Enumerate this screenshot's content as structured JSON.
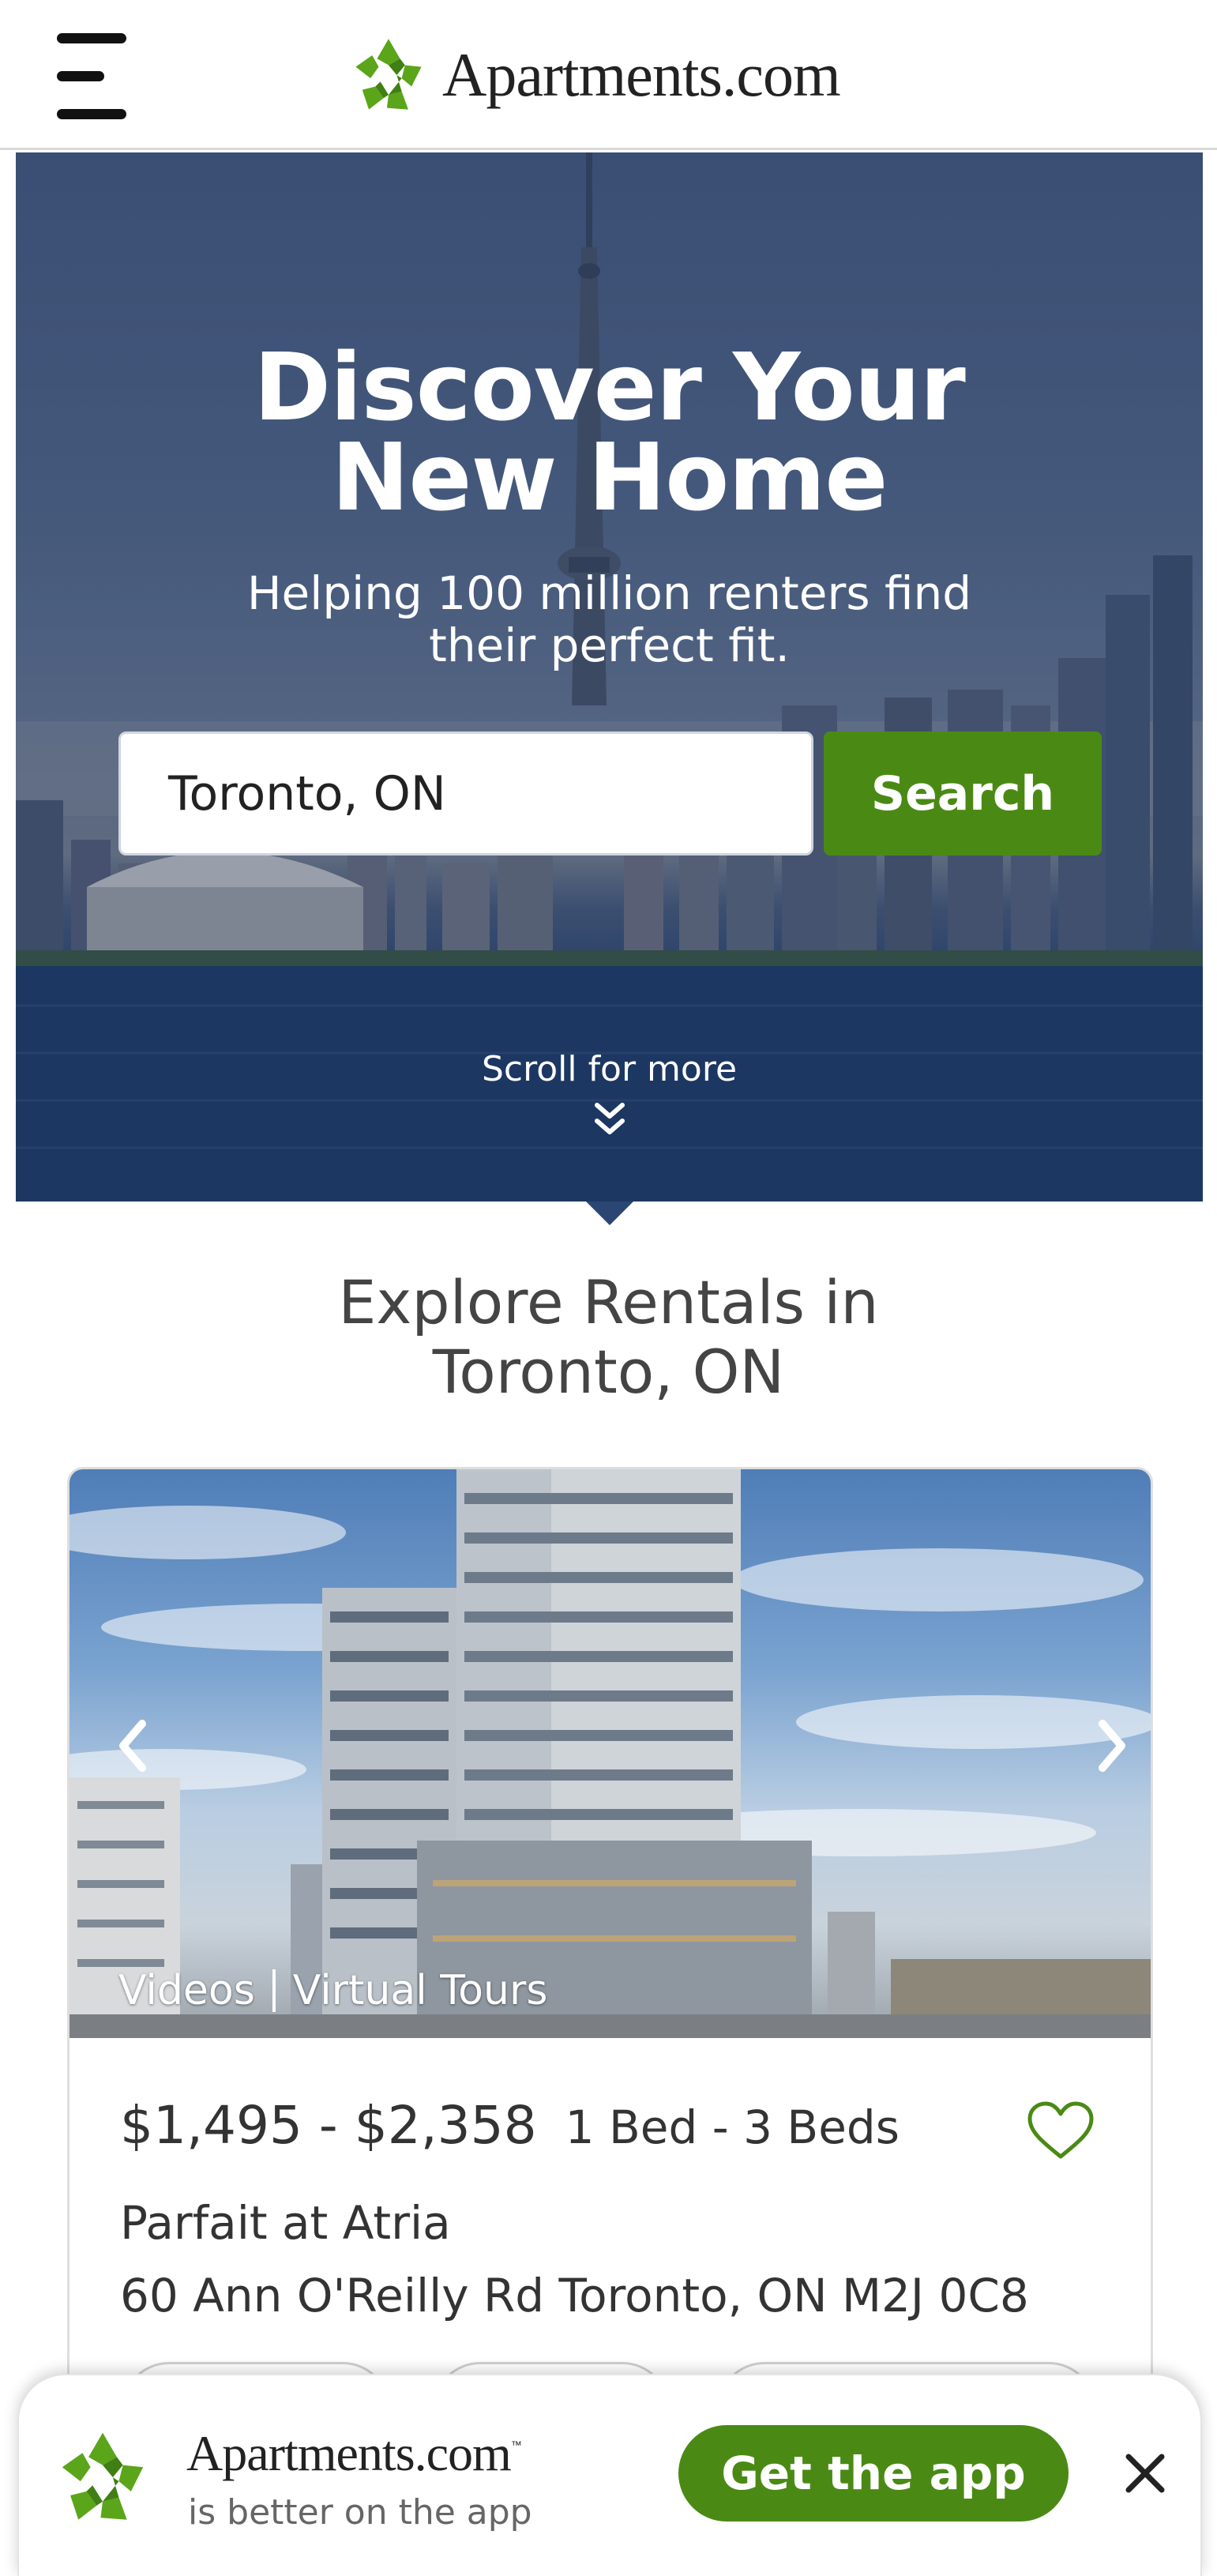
{
  "header": {
    "menu_icon": "hamburger-menu-icon",
    "logo_icon": "apartments-logo-icon",
    "brand": "Apartments.com",
    "brand_color": "#4a8a14"
  },
  "hero": {
    "title_line1": "Discover Your",
    "title_line2": "New Home",
    "subtitle_line1": "Helping 100 million renters find",
    "subtitle_line2": "their perfect fit.",
    "search_value": "Toronto, ON",
    "search_button": "Search",
    "scroll_text": "Scroll for more",
    "scroll_icon": "double-chevron-down-icon"
  },
  "explore": {
    "title_line1": "Explore Rentals in",
    "title_line2": "Toronto, ON"
  },
  "listing": {
    "photo_tags": [
      "Videos",
      "Virtual Tours"
    ],
    "price": "$1,495 - $2,358",
    "beds": "1 Bed - 3 Beds",
    "name": "Parfait at Atria",
    "address": "60 Ann O'Reilly Rd Toronto, ON M2J 0C8",
    "favorite_icon": "heart-outline-icon",
    "prev_icon": "chevron-left-icon",
    "next_icon": "chevron-right-icon"
  },
  "app_banner": {
    "brand": "Apartments.com",
    "trademark": "™",
    "subtitle": "is better on the app",
    "button": "Get the app",
    "close_icon": "close-icon"
  }
}
